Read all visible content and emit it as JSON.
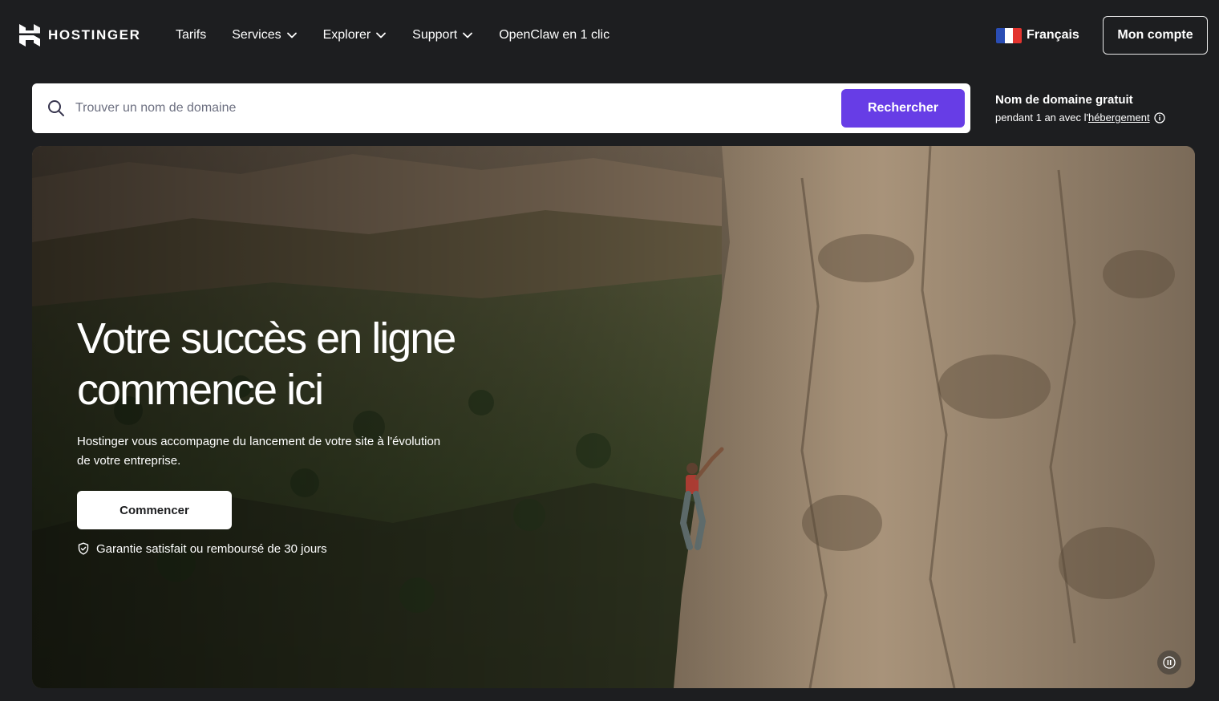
{
  "brand": {
    "name": "HOSTINGER",
    "logo_icon": "hostinger-h-logo-icon"
  },
  "nav": {
    "items": [
      {
        "label": "Tarifs",
        "has_dropdown": false
      },
      {
        "label": "Services",
        "has_dropdown": true
      },
      {
        "label": "Explorer",
        "has_dropdown": true
      },
      {
        "label": "Support",
        "has_dropdown": true
      },
      {
        "label": "OpenClaw en 1 clic",
        "has_dropdown": false
      }
    ],
    "language": {
      "label": "Français",
      "flag_icon": "france-flag-icon"
    },
    "account_label": "Mon compte"
  },
  "search": {
    "placeholder": "Trouver un nom de domaine",
    "value": "",
    "button_label": "Rechercher",
    "icon": "search-icon"
  },
  "promo": {
    "title": "Nom de domaine gratuit",
    "sub_prefix": "pendant 1 an avec l'",
    "sub_link": "hébergement",
    "icon": "info-icon"
  },
  "hero": {
    "title_line1": "Votre succès en ligne",
    "title_line2": "commence ici",
    "description": "Hostinger vous accompagne du lancement de votre site à l'évolution de votre entreprise.",
    "cta_label": "Commencer",
    "guarantee": "Garantie satisfait ou remboursé de 30 jours",
    "video_control_icon": "pause-icon"
  },
  "colors": {
    "page_bg": "#1d1e20",
    "accent": "#673de6",
    "text": "#ffffff",
    "search_bg": "#ffffff"
  }
}
